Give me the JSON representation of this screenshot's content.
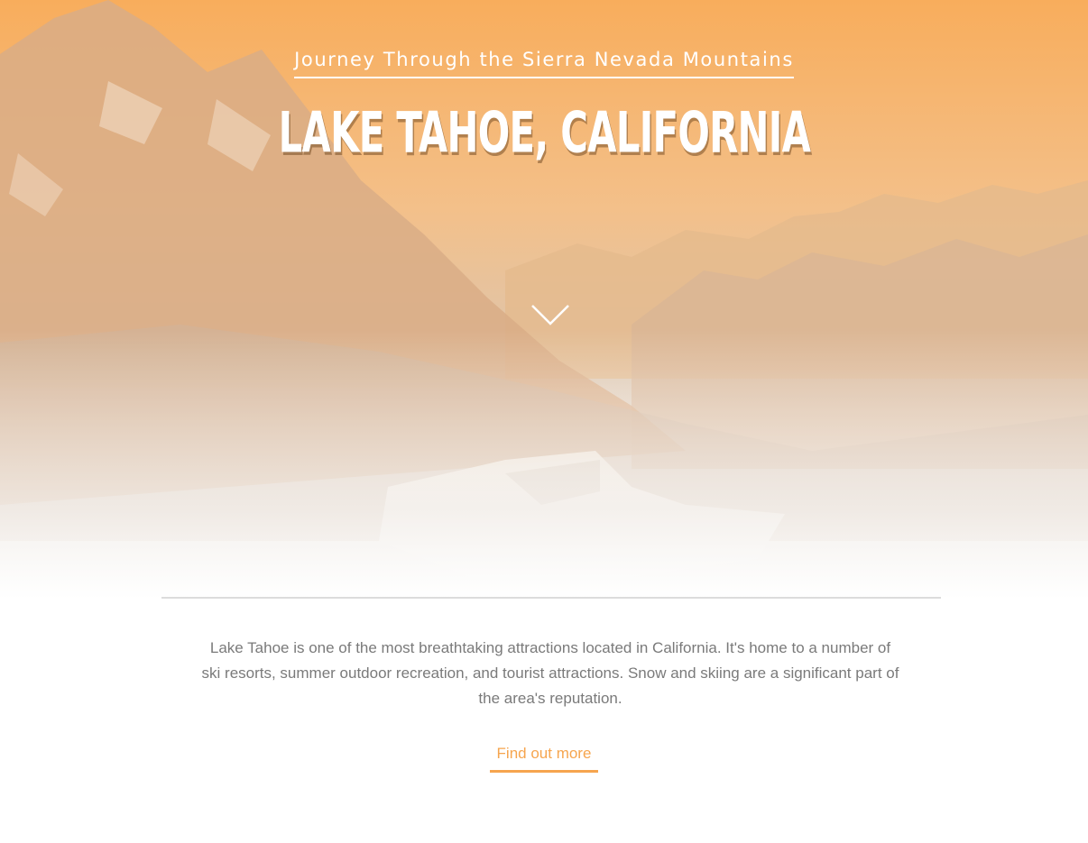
{
  "hero": {
    "subtitle": "Journey Through the Sierra Nevada Mountains",
    "title": "LAKE TAHOE, CALIFORNIA",
    "background_image": "mountain-lake-landscape",
    "scroll_icon": "chevron-down-icon"
  },
  "content": {
    "description": "Lake Tahoe is one of the most breathtaking attractions located in California. It's home to a number of ski resorts, summer outdoor recreation, and tourist attractions. Snow and skiing are a significant part of the area's reputation.",
    "cta_label": "Find out more"
  },
  "colors": {
    "accent": "#f6a54e",
    "hero_tint_top": "#f8b060",
    "body_text": "#7a7a7a",
    "divider": "#dcdcdc"
  }
}
